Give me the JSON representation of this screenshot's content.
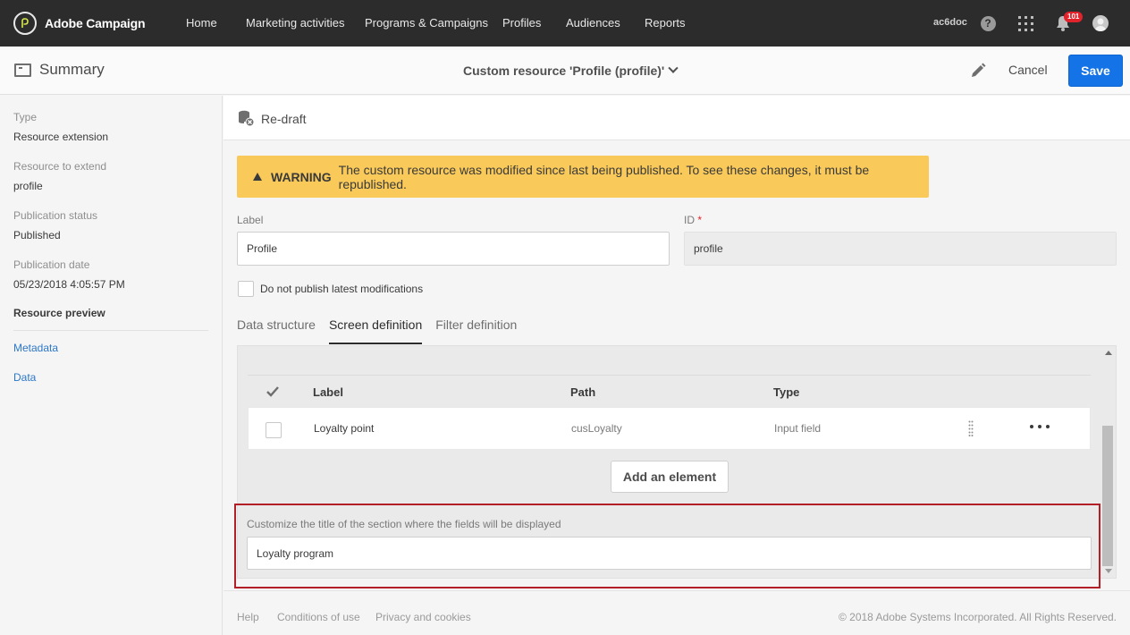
{
  "app": {
    "brand": "Adobe Campaign"
  },
  "nav": {
    "items": [
      "Home",
      "Marketing activities",
      "Programs & Campaigns",
      "Profiles",
      "Audiences",
      "Reports"
    ],
    "org": "ac6doc",
    "notification_count": "101",
    "icons": [
      "help-icon",
      "apps-grid-icon",
      "bell-icon",
      "avatar"
    ]
  },
  "actionbar": {
    "summary_label": "Summary",
    "resource_title": "Custom resource 'Profile (profile)'",
    "cancel_label": "Cancel",
    "save_label": "Save"
  },
  "sidebar": {
    "meta": [
      {
        "label": "Type",
        "value": "Resource extension"
      },
      {
        "label": "Resource to extend",
        "value": "profile"
      },
      {
        "label": "Publication status",
        "value": "Published"
      },
      {
        "label": "Publication date",
        "value": "05/23/2018 4:05:57 PM"
      }
    ],
    "preview_heading": "Resource preview",
    "links": [
      "Metadata",
      "Data"
    ]
  },
  "main": {
    "redraft_label": "Re-draft",
    "warning": {
      "title": "WARNING",
      "message": "The custom resource was modified since last being published. To see these changes, it must be republished."
    },
    "label_field": {
      "label": "Label",
      "value": "Profile"
    },
    "id_field": {
      "label": "ID",
      "required_marker": "*",
      "value": "profile"
    },
    "do_not_publish_label": "Do not publish latest modifications",
    "tabs": [
      "Data structure",
      "Screen definition",
      "Filter definition"
    ],
    "active_tab": "Screen definition",
    "table": {
      "columns": [
        "Label",
        "Path",
        "Type"
      ],
      "rows": [
        {
          "label": "Loyalty point",
          "path": "cusLoyalty",
          "type": "Input field"
        }
      ]
    },
    "add_element_label": "Add an element",
    "section_title": {
      "label": "Customize the title of the section where the fields will be displayed",
      "value": "Loyalty program"
    }
  },
  "footer": {
    "links": [
      "Help",
      "Conditions of use",
      "Privacy and cookies"
    ],
    "copyright": "© 2018 Adobe Systems Incorporated. All Rights Reserved."
  },
  "colors": {
    "topbar": "#2c2c2c",
    "accent_blue": "#1473e6",
    "warning": "#f9c95a",
    "highlight_border": "#b21f27",
    "link": "#2d77c8"
  }
}
